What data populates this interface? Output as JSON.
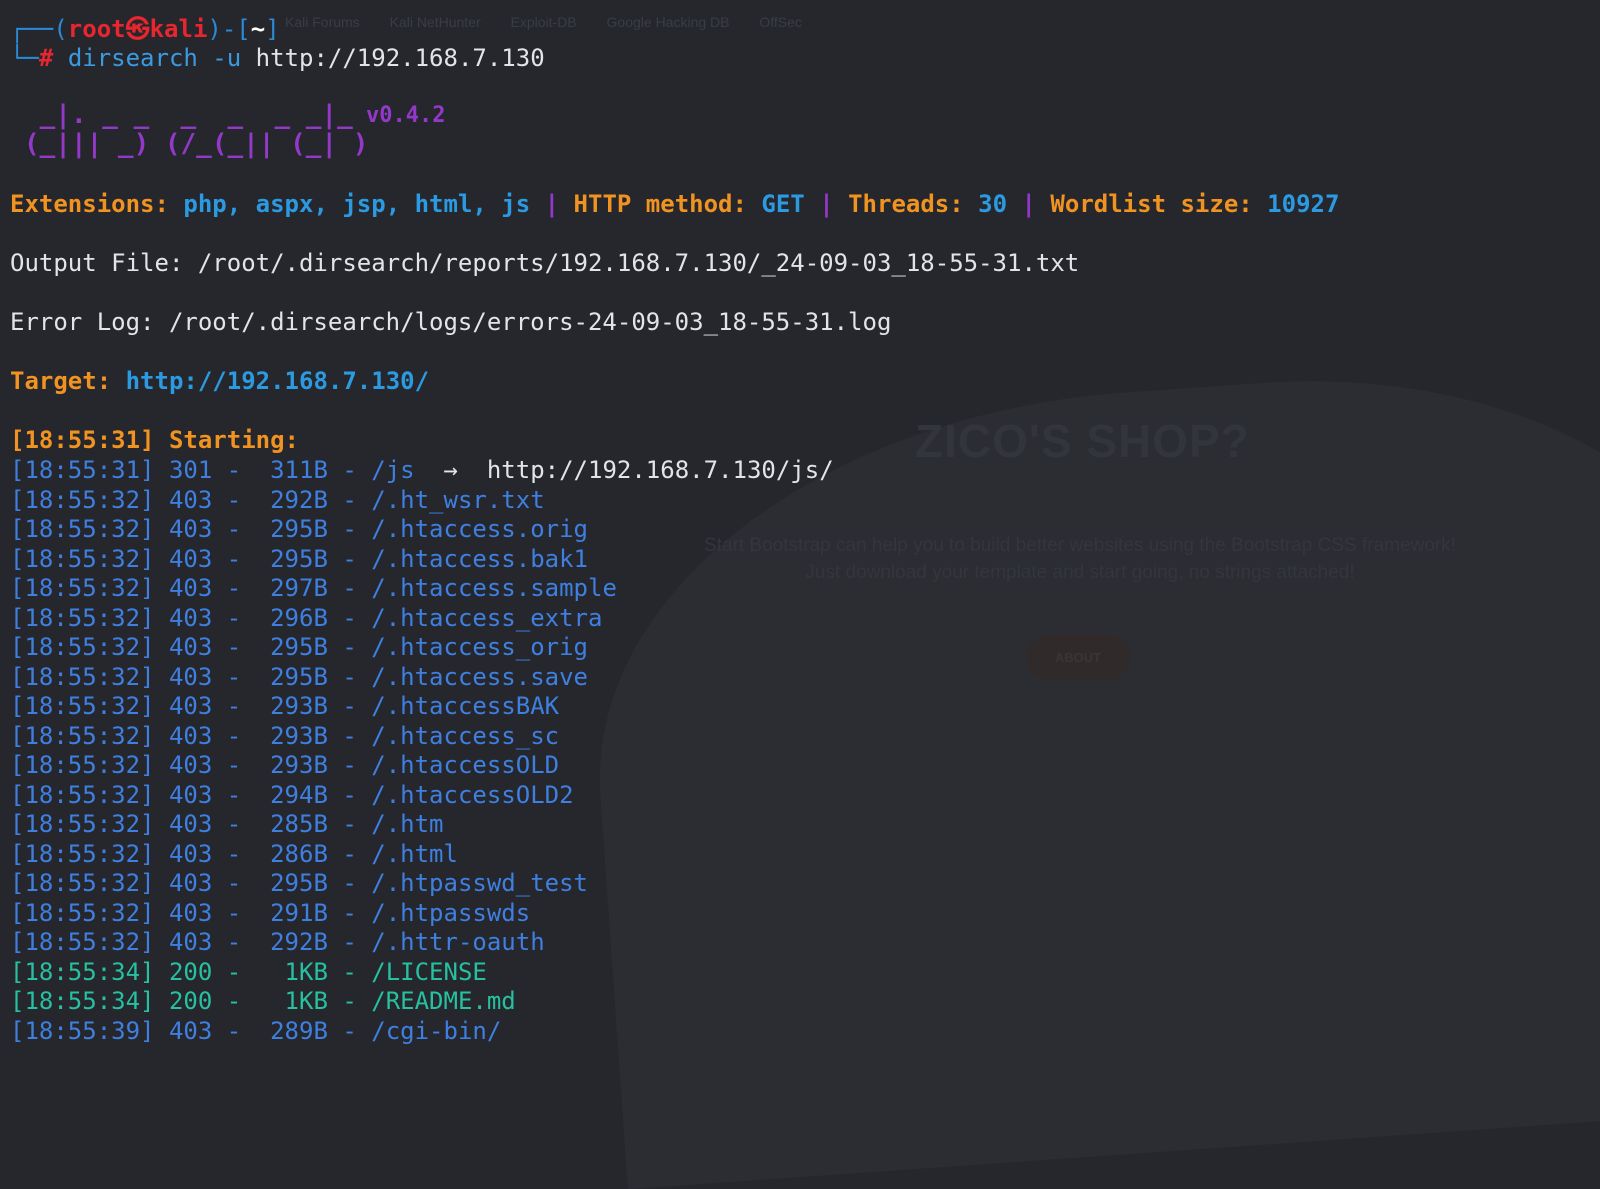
{
  "background_page": {
    "bookmarks": [
      "Kali Forums",
      "Kali NetHunter",
      "Exploit-DB",
      "Google Hacking DB",
      "OffSec"
    ],
    "hero_title": "ZICO'S SHOP?",
    "hero_text_1": "Start Bootstrap can help you to build better websites using the Bootstrap CSS framework!",
    "hero_text_2": "Just download your template and start going, no strings attached!",
    "hero_button": "ABOUT"
  },
  "prompt": {
    "frame_top_left": "┌──(",
    "user": "root",
    "skull": "㉿",
    "host": "kali",
    "frame_mid": ")-[",
    "dir": "~",
    "frame_end": "]",
    "frame_bottom": "└─",
    "hash": "#",
    "command": "dirsearch -u",
    "url": "http://192.168.7.130"
  },
  "banner": {
    "ascii_line1": " _|. _ _  _  _  _ _|_",
    "ascii_line2": "(_||| _) (/_(_|| (_| )",
    "version": "v0.4.2"
  },
  "config": {
    "ext_label": "Extensions:",
    "ext_value": "php, aspx, jsp, html, js",
    "method_label": "HTTP method:",
    "method_value": "GET",
    "threads_label": "Threads:",
    "threads_value": "30",
    "wordlist_label": "Wordlist size:",
    "wordlist_value": "10927",
    "sep": "|"
  },
  "output_file": "Output File: /root/.dirsearch/reports/192.168.7.130/_24-09-03_18-55-31.txt",
  "error_log": "Error Log: /root/.dirsearch/logs/errors-24-09-03_18-55-31.log",
  "target": {
    "label": "Target:",
    "url": "http://192.168.7.130/"
  },
  "starting": "[18:55:31] Starting:",
  "colors": {
    "redirect_row": "#3f7fe0",
    "forbidden_row": "#3f7fe0",
    "ok_row": "#27c0a0",
    "accent_orange": "#f09320",
    "accent_blue": "#2b9ae0",
    "accent_purple": "#9438c9"
  },
  "results": [
    {
      "time": "[18:55:31]",
      "code": "301",
      "size": "311B",
      "path": "/js",
      "arrow": "->",
      "redirect": "http://192.168.7.130/js/",
      "kind": "redirect"
    },
    {
      "time": "[18:55:32]",
      "code": "403",
      "size": "292B",
      "path": "/.ht_wsr.txt",
      "kind": "forbidden"
    },
    {
      "time": "[18:55:32]",
      "code": "403",
      "size": "295B",
      "path": "/.htaccess.orig",
      "kind": "forbidden"
    },
    {
      "time": "[18:55:32]",
      "code": "403",
      "size": "295B",
      "path": "/.htaccess.bak1",
      "kind": "forbidden"
    },
    {
      "time": "[18:55:32]",
      "code": "403",
      "size": "297B",
      "path": "/.htaccess.sample",
      "kind": "forbidden"
    },
    {
      "time": "[18:55:32]",
      "code": "403",
      "size": "296B",
      "path": "/.htaccess_extra",
      "kind": "forbidden"
    },
    {
      "time": "[18:55:32]",
      "code": "403",
      "size": "295B",
      "path": "/.htaccess_orig",
      "kind": "forbidden"
    },
    {
      "time": "[18:55:32]",
      "code": "403",
      "size": "295B",
      "path": "/.htaccess.save",
      "kind": "forbidden"
    },
    {
      "time": "[18:55:32]",
      "code": "403",
      "size": "293B",
      "path": "/.htaccessBAK",
      "kind": "forbidden"
    },
    {
      "time": "[18:55:32]",
      "code": "403",
      "size": "293B",
      "path": "/.htaccess_sc",
      "kind": "forbidden"
    },
    {
      "time": "[18:55:32]",
      "code": "403",
      "size": "293B",
      "path": "/.htaccessOLD",
      "kind": "forbidden"
    },
    {
      "time": "[18:55:32]",
      "code": "403",
      "size": "294B",
      "path": "/.htaccessOLD2",
      "kind": "forbidden"
    },
    {
      "time": "[18:55:32]",
      "code": "403",
      "size": "285B",
      "path": "/.htm",
      "kind": "forbidden"
    },
    {
      "time": "[18:55:32]",
      "code": "403",
      "size": "286B",
      "path": "/.html",
      "kind": "forbidden"
    },
    {
      "time": "[18:55:32]",
      "code": "403",
      "size": "295B",
      "path": "/.htpasswd_test",
      "kind": "forbidden"
    },
    {
      "time": "[18:55:32]",
      "code": "403",
      "size": "291B",
      "path": "/.htpasswds",
      "kind": "forbidden"
    },
    {
      "time": "[18:55:32]",
      "code": "403",
      "size": "292B",
      "path": "/.httr-oauth",
      "kind": "forbidden"
    },
    {
      "time": "[18:55:34]",
      "code": "200",
      "size": "1KB",
      "path": "/LICENSE",
      "kind": "ok"
    },
    {
      "time": "[18:55:34]",
      "code": "200",
      "size": "1KB",
      "path": "/README.md",
      "kind": "ok"
    },
    {
      "time": "[18:55:39]",
      "code": "403",
      "size": "289B",
      "path": "/cgi-bin/",
      "kind": "forbidden"
    }
  ]
}
